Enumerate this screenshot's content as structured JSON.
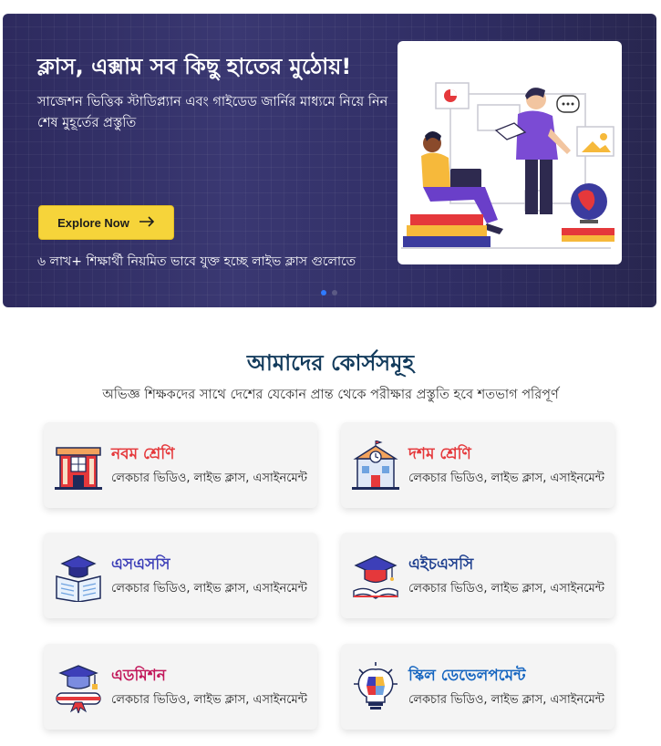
{
  "hero": {
    "title": "ক্লাস, এক্সাম সব কিছু হাতের মুঠোয়!",
    "subtitle": "সাজেশন ভিত্তিক স্টাডিপ্ল্যান এবং গাইডেড জার্নির মাধ্যমে নিয়ে নিন শেষ মুহূর্তের প্রস্তুতি",
    "button_label": "Explore Now",
    "note": "৬ লাখ+ শিক্ষার্থী নিয়মিত ভাবে যুক্ত হচ্ছে লাইভ ক্লাস গুলোতে",
    "accent": "#f6d43a"
  },
  "courses": {
    "title": "আমাদের কোর্সসমূহ",
    "subtitle": "অভিজ্ঞ শিক্ষকদের সাথে দেশের যেকোন প্রান্ত থেকে পরীক্ষার প্রস্তুতি হবে শতভাগ পরিপূর্ণ",
    "items": [
      {
        "title": "নবম শ্রেণি",
        "desc": "লেকচার ভিডিও, লাইভ ক্লাস, এসাইনমেন্ট",
        "color": "#e5383b",
        "icon": "school-building-icon"
      },
      {
        "title": "দশম শ্রেণি",
        "desc": "লেকচার ভিডিও, লাইভ ক্লাস, এসাইনমেন্ট",
        "color": "#e5383b",
        "icon": "clock-school-icon"
      },
      {
        "title": "এসএসসি",
        "desc": "লেকচার ভিডিও, লাইভ ক্লাস, এসাইনমেন্ট",
        "color": "#3d3fb8",
        "icon": "graduation-book-icon"
      },
      {
        "title": "এইচএসসি",
        "desc": "লেকচার ভিডিও, লাইভ ক্লাস, এসাইনমেন্ট",
        "color": "#1e3f8f",
        "icon": "graduation-cap-book-icon"
      },
      {
        "title": "এডমিশন",
        "desc": "লেকচার ভিডিও, লাইভ ক্লাস, এসাইনমেন্ট",
        "color": "#c2185b",
        "icon": "diploma-cap-icon"
      },
      {
        "title": "স্কিল ডেভেলপমেন্ট",
        "desc": "লেকচার ভিডিও, লাইভ ক্লাস, এসাইনমেন্ট",
        "color": "#1565c0",
        "icon": "lightbulb-puzzle-icon"
      }
    ]
  }
}
